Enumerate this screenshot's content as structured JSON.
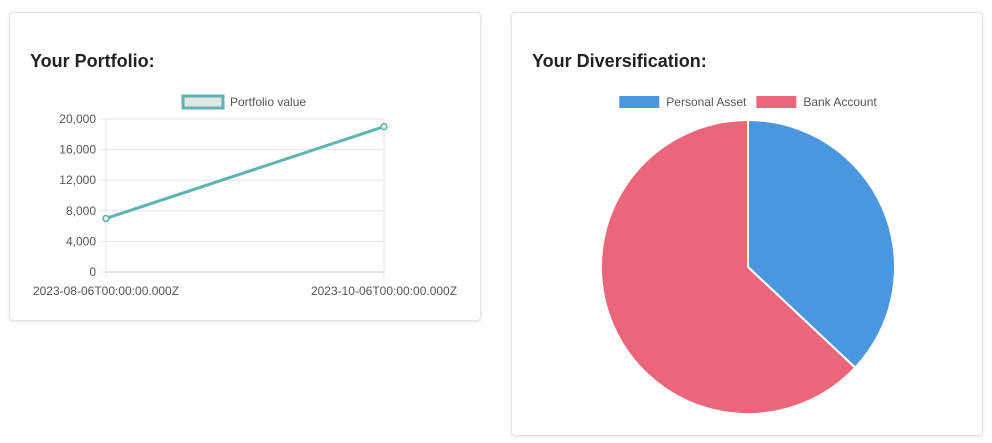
{
  "portfolio": {
    "title": "Your Portfolio:",
    "chart_data": {
      "type": "line",
      "x": [
        "2023-08-06T00:00:00.000Z",
        "2023-10-06T00:00:00.000Z"
      ],
      "series": [
        {
          "name": "Portfolio value",
          "values": [
            7000,
            19000
          ],
          "color": "#5fb3b3"
        }
      ],
      "yticks": [
        "0",
        "4,000",
        "8,000",
        "12,000",
        "16,000",
        "20,000"
      ],
      "ylim": [
        0,
        20000
      ],
      "grid": true,
      "legend": "top"
    }
  },
  "diversification": {
    "title": "Your Diversification:",
    "chart_data": {
      "type": "pie",
      "labels": [
        "Personal Asset",
        "Bank Account"
      ],
      "values": [
        37,
        63
      ],
      "colors": [
        "#4a97e0",
        "#eb667b"
      ],
      "legend": "top"
    }
  }
}
